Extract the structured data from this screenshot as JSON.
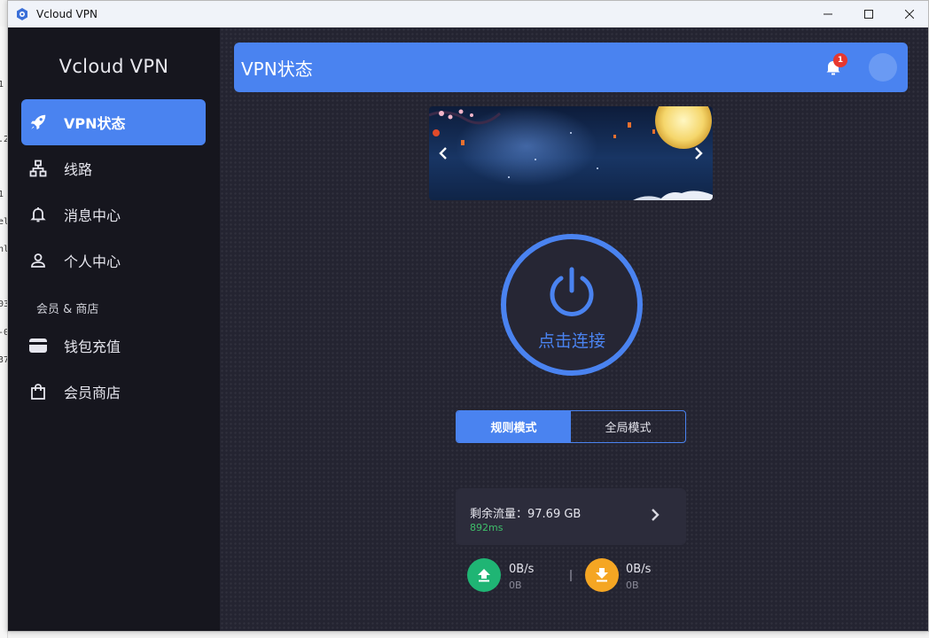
{
  "window": {
    "title": "Vcloud VPN"
  },
  "sidebar": {
    "brand": "Vcloud VPN",
    "items": [
      {
        "label": "VPN状态",
        "icon": "rocket-icon",
        "active": true
      },
      {
        "label": "线路",
        "icon": "network-icon"
      },
      {
        "label": "消息中心",
        "icon": "bell-icon"
      },
      {
        "label": "个人中心",
        "icon": "user-icon"
      }
    ],
    "section": "会员 & 商店",
    "section_items": [
      {
        "label": "钱包充值",
        "icon": "wallet-icon"
      },
      {
        "label": "会员商店",
        "icon": "shopping-bag-icon"
      }
    ]
  },
  "header": {
    "title": "VPN状态",
    "notification_count": "1"
  },
  "connect": {
    "label": "点击连接"
  },
  "mode": {
    "options": [
      "规则模式",
      "全局模式"
    ],
    "selected": "规则模式"
  },
  "traffic": {
    "remaining_label": "剩余流量：97.69 GB",
    "latency": "892ms"
  },
  "speed": {
    "upload": {
      "rate": "0B/s",
      "total": "0B"
    },
    "download": {
      "rate": "0B/s",
      "total": "0B"
    }
  },
  "colors": {
    "accent": "#4a83f0",
    "sidebar_bg": "#16161e",
    "main_bg": "#242431",
    "upload": "#1fb574",
    "download": "#f5a623",
    "badge": "#e6382f",
    "latency": "#3fbf6a"
  },
  "background_window_fragments": [
    "1",
    ".2",
    "1",
    "el",
    "nl",
    "03",
    "-0",
    "37"
  ]
}
